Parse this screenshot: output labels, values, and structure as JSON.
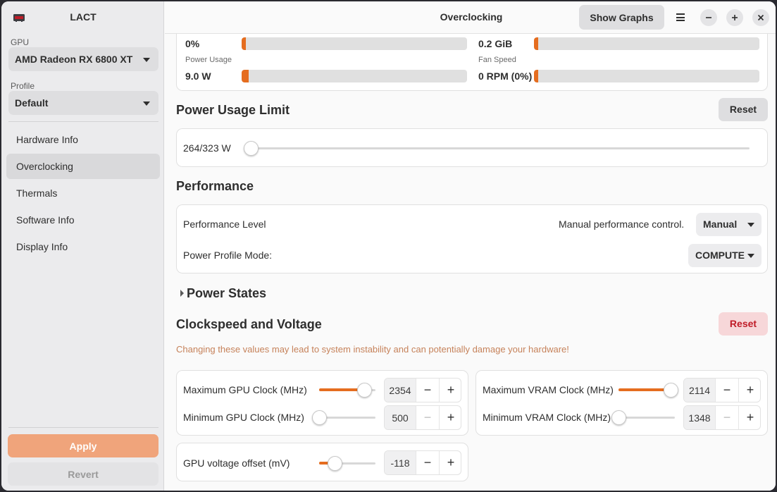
{
  "app": {
    "title": "LACT"
  },
  "sidebar": {
    "gpu_label": "GPU",
    "gpu_value": "AMD Radeon RX 6800 XT",
    "profile_label": "Profile",
    "profile_value": "Default",
    "items": [
      {
        "label": "Hardware Info"
      },
      {
        "label": "Overclocking"
      },
      {
        "label": "Thermals"
      },
      {
        "label": "Software Info"
      },
      {
        "label": "Display Info"
      }
    ],
    "active_item": "Overclocking",
    "apply_label": "Apply",
    "revert_label": "Revert"
  },
  "header": {
    "title": "Overclocking",
    "show_graphs_label": "Show Graphs",
    "menu_icon": "hamburger-menu-icon",
    "minimize_icon": "minimize-icon",
    "maximize_icon": "maximize-icon",
    "close_icon": "close-icon"
  },
  "stats": {
    "gpu_usage_value": "0%",
    "gpu_usage_fraction": 0.01,
    "vram_value": "0.2 GiB",
    "vram_fraction": 0.01,
    "power_usage_label": "Power Usage",
    "power_usage_value": "9.0 W",
    "power_usage_fraction": 0.03,
    "fan_speed_label": "Fan Speed",
    "fan_speed_value": "0 RPM (0%)",
    "fan_speed_fraction": 0.0
  },
  "power_limit": {
    "title": "Power Usage Limit",
    "reset_label": "Reset",
    "value_text": "264/323 W",
    "slider_fraction": 0.0
  },
  "performance": {
    "title": "Performance",
    "level_label": "Performance Level",
    "level_hint": "Manual performance control.",
    "level_value": "Manual",
    "profile_mode_label": "Power Profile Mode:",
    "profile_mode_value": "COMPUTE"
  },
  "power_states": {
    "title": "Power States"
  },
  "clocks": {
    "title": "Clockspeed and Voltage",
    "reset_label": "Reset",
    "warning": "Changing these values may lead to system instability and can potentially damage your hardware!",
    "max_gpu_label": "Maximum GPU Clock (MHz)",
    "max_gpu_value": "2354",
    "max_gpu_fraction": 0.8,
    "min_gpu_label": "Minimum GPU Clock (MHz)",
    "min_gpu_value": "500",
    "min_gpu_fraction": 0.0,
    "max_vram_label": "Maximum VRAM Clock (MHz)",
    "max_vram_value": "2114",
    "max_vram_fraction": 0.92,
    "min_vram_label": "Minimum VRAM Clock (MHz)",
    "min_vram_value": "1348",
    "min_vram_fraction": 0.0,
    "voltage_label": "GPU voltage offset (mV)",
    "voltage_value": "-118",
    "voltage_fraction": 0.27,
    "minus_symbol": "−",
    "plus_symbol": "+"
  },
  "colors": {
    "accent": "#e56d1f",
    "apply_bg": "#f0a47b",
    "destructive": "#c01c28",
    "warning_text": "#c6825a"
  }
}
